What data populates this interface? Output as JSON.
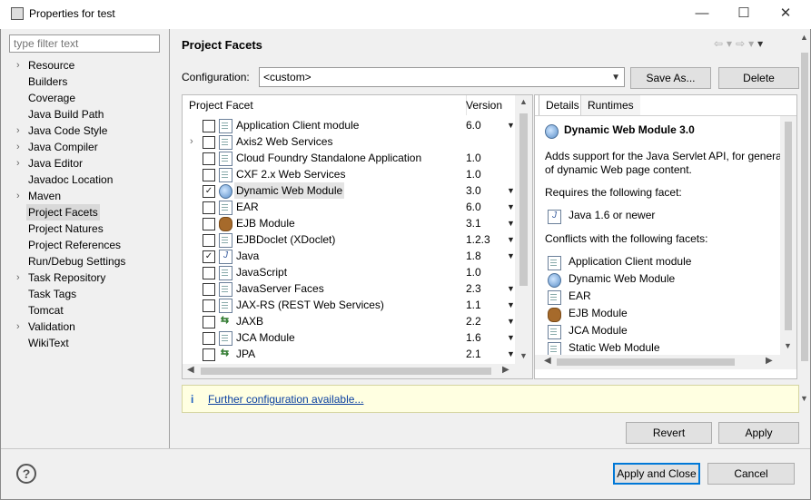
{
  "window": {
    "title": "Properties for test",
    "minimize": "—",
    "maximize": "☐",
    "close": "✕"
  },
  "filter": {
    "placeholder": "type filter text"
  },
  "sidebar": {
    "items": [
      {
        "label": "Resource",
        "expandable": true
      },
      {
        "label": "Builders",
        "expandable": false
      },
      {
        "label": "Coverage",
        "expandable": false
      },
      {
        "label": "Java Build Path",
        "expandable": false
      },
      {
        "label": "Java Code Style",
        "expandable": true
      },
      {
        "label": "Java Compiler",
        "expandable": true
      },
      {
        "label": "Java Editor",
        "expandable": true
      },
      {
        "label": "Javadoc Location",
        "expandable": false
      },
      {
        "label": "Maven",
        "expandable": true
      },
      {
        "label": "Project Facets",
        "expandable": false,
        "selected": true
      },
      {
        "label": "Project Natures",
        "expandable": false
      },
      {
        "label": "Project References",
        "expandable": false
      },
      {
        "label": "Run/Debug Settings",
        "expandable": false
      },
      {
        "label": "Task Repository",
        "expandable": true
      },
      {
        "label": "Task Tags",
        "expandable": false
      },
      {
        "label": "Tomcat",
        "expandable": false
      },
      {
        "label": "Validation",
        "expandable": true
      },
      {
        "label": "WikiText",
        "expandable": false
      }
    ]
  },
  "main": {
    "title": "Project Facets",
    "configuration": {
      "label": "Configuration:",
      "value": "<custom>"
    },
    "save_as": "Save As...",
    "delete": "Delete",
    "facets_header": {
      "facet": "Project Facet",
      "version": "Version"
    },
    "facets": [
      {
        "name": "Application Client module",
        "version": "6.0",
        "checked": false,
        "icon": "doc",
        "dropdown": true,
        "expandable": false
      },
      {
        "name": "Axis2 Web Services",
        "version": "",
        "checked": false,
        "icon": "doc",
        "dropdown": false,
        "expandable": true
      },
      {
        "name": "Cloud Foundry Standalone Application",
        "version": "1.0",
        "checked": false,
        "icon": "doc",
        "dropdown": false,
        "expandable": false
      },
      {
        "name": "CXF 2.x Web Services",
        "version": "1.0",
        "checked": false,
        "icon": "doc",
        "dropdown": false,
        "expandable": false
      },
      {
        "name": "Dynamic Web Module",
        "version": "3.0",
        "checked": true,
        "icon": "globe",
        "dropdown": true,
        "expandable": false,
        "selected": true
      },
      {
        "name": "EAR",
        "version": "6.0",
        "checked": false,
        "icon": "doc",
        "dropdown": true,
        "expandable": false
      },
      {
        "name": "EJB Module",
        "version": "3.1",
        "checked": false,
        "icon": "bean",
        "dropdown": true,
        "expandable": false
      },
      {
        "name": "EJBDoclet (XDoclet)",
        "version": "1.2.3",
        "checked": false,
        "icon": "doc",
        "dropdown": true,
        "expandable": false
      },
      {
        "name": "Java",
        "version": "1.8",
        "checked": true,
        "icon": "java",
        "dropdown": true,
        "expandable": false
      },
      {
        "name": "JavaScript",
        "version": "1.0",
        "checked": false,
        "icon": "doc",
        "dropdown": false,
        "expandable": false
      },
      {
        "name": "JavaServer Faces",
        "version": "2.3",
        "checked": false,
        "icon": "doc",
        "dropdown": true,
        "expandable": false
      },
      {
        "name": "JAX-RS (REST Web Services)",
        "version": "1.1",
        "checked": false,
        "icon": "doc",
        "dropdown": true,
        "expandable": false
      },
      {
        "name": "JAXB",
        "version": "2.2",
        "checked": false,
        "icon": "xf",
        "dropdown": true,
        "expandable": false
      },
      {
        "name": "JCA Module",
        "version": "1.6",
        "checked": false,
        "icon": "doc",
        "dropdown": true,
        "expandable": false
      },
      {
        "name": "JPA",
        "version": "2.1",
        "checked": false,
        "icon": "xf",
        "dropdown": true,
        "expandable": false
      }
    ],
    "tabs": [
      "Details",
      "Runtimes"
    ],
    "details": {
      "heading": "Dynamic Web Module 3.0",
      "description_1": "Adds support for the Java Servlet API, for generat",
      "description_2": "of dynamic Web page content.",
      "requires_label": "Requires the following facet:",
      "requires": [
        {
          "name": "Java 1.6 or newer",
          "icon": "java"
        }
      ],
      "conflicts_label": "Conflicts with the following facets:",
      "conflicts": [
        {
          "name": "Application Client module",
          "icon": "doc"
        },
        {
          "name": "Dynamic Web Module",
          "icon": "globe"
        },
        {
          "name": "EAR",
          "icon": "doc"
        },
        {
          "name": "EJB Module",
          "icon": "bean"
        },
        {
          "name": "JCA Module",
          "icon": "doc"
        },
        {
          "name": "Static Web Module",
          "icon": "doc"
        }
      ]
    },
    "info": {
      "link": "Further configuration available..."
    },
    "revert": "Revert",
    "apply": "Apply"
  },
  "footer": {
    "help": "?",
    "apply_close": "Apply and Close",
    "cancel": "Cancel"
  }
}
